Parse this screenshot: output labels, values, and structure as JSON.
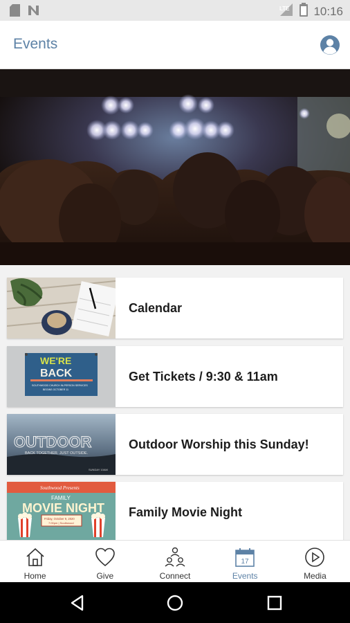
{
  "status_bar": {
    "time": "10:16",
    "network": "LTE",
    "icons": [
      "sd-card-icon",
      "notification-n-icon",
      "signal-icon",
      "battery-icon"
    ]
  },
  "header": {
    "title": "Events",
    "profile_icon": "profile-icon"
  },
  "events": [
    {
      "label": "Calendar",
      "thumb": "calendar-thumbnail"
    },
    {
      "label": "Get Tickets / 9:30 & 11am",
      "thumb": "tickets-thumbnail",
      "thumb_text": [
        "WE'RE",
        "BACK",
        "SOUTHWOOD CHURCH IN-PERSON SERVICES",
        "BEGINS OCTOBER 11"
      ]
    },
    {
      "label": "Outdoor Worship this Sunday!",
      "thumb": "outdoor-thumbnail",
      "thumb_text": [
        "OUTDOOR",
        "BACK TOGETHER. JUST OUTSIDE.",
        "SUNDAY 10AM"
      ]
    },
    {
      "label": "Family Movie Night",
      "thumb": "movie-night-thumbnail",
      "thumb_text": [
        "Southwood Presents",
        "FAMILY",
        "MOVIE NIGHT",
        "Friday, October 9, 2020",
        "7:00pm | Southwood"
      ]
    }
  ],
  "bottom_nav": [
    {
      "label": "Home",
      "icon": "home-icon",
      "active": false
    },
    {
      "label": "Give",
      "icon": "heart-icon",
      "active": false
    },
    {
      "label": "Connect",
      "icon": "connect-icon",
      "active": false
    },
    {
      "label": "Events",
      "icon": "calendar-icon",
      "active": true,
      "badge": "17"
    },
    {
      "label": "Media",
      "icon": "play-icon",
      "active": false
    }
  ],
  "colors": {
    "accent": "#5d82a6",
    "status_bar": "#e8e8e8",
    "list_bg": "#f2f2f2",
    "text": "#1c1c1c"
  }
}
